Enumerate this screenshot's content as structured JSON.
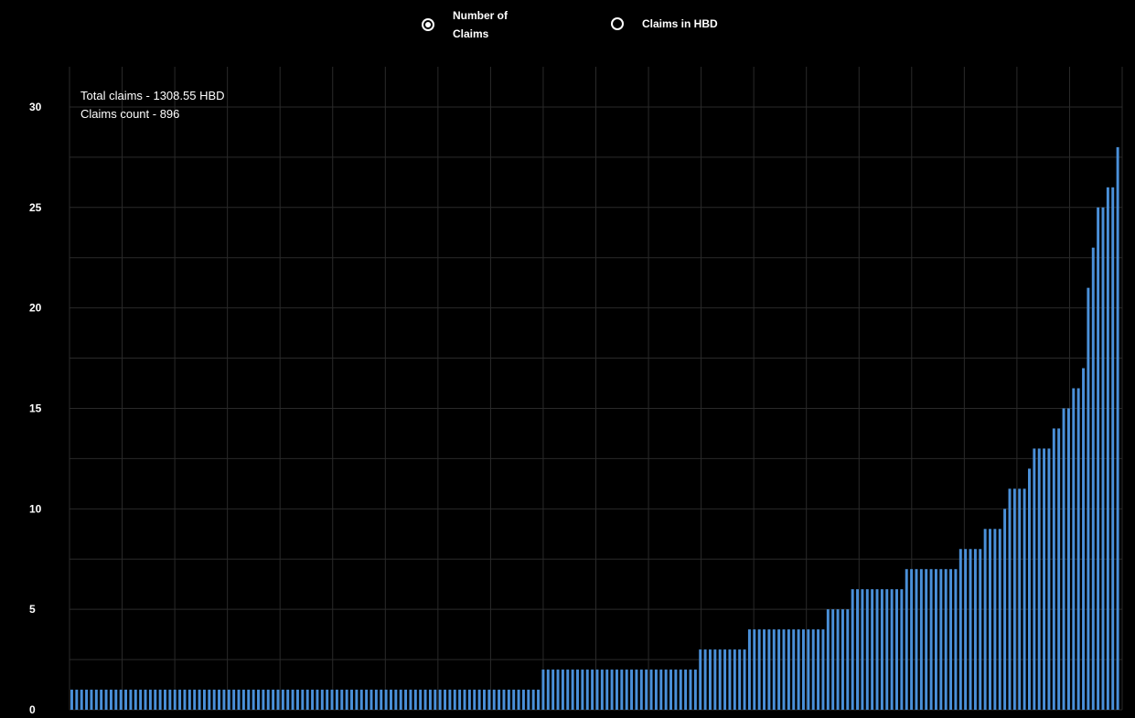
{
  "toggle": {
    "options": [
      {
        "label": "Number of Claims",
        "checked": true
      },
      {
        "label": "Claims in HBD",
        "checked": false
      }
    ]
  },
  "summary": {
    "total_claims": "Total claims - 1308.55 HBD",
    "claims_count": "Claims count - 896"
  },
  "colors": {
    "background": "#000000",
    "bar": "#4a90d9",
    "grid": "#2a2a2a",
    "text": "#ffffff"
  },
  "chart_data": {
    "type": "bar",
    "title": "",
    "xlabel": "",
    "ylabel": "",
    "ylim": [
      0,
      32
    ],
    "yticks": [
      0,
      5,
      10,
      15,
      20,
      25,
      30
    ],
    "grid": true,
    "legend": "none",
    "values": [
      1,
      1,
      1,
      1,
      1,
      1,
      1,
      1,
      1,
      1,
      1,
      1,
      1,
      1,
      1,
      1,
      1,
      1,
      1,
      1,
      1,
      1,
      1,
      1,
      1,
      1,
      1,
      1,
      1,
      1,
      1,
      1,
      1,
      1,
      1,
      1,
      1,
      1,
      1,
      1,
      1,
      1,
      1,
      1,
      1,
      1,
      1,
      1,
      1,
      1,
      1,
      1,
      1,
      1,
      1,
      1,
      1,
      1,
      1,
      1,
      1,
      1,
      1,
      1,
      1,
      1,
      1,
      1,
      1,
      1,
      1,
      1,
      1,
      1,
      1,
      1,
      1,
      1,
      1,
      1,
      1,
      1,
      1,
      1,
      1,
      1,
      1,
      1,
      1,
      1,
      1,
      1,
      1,
      1,
      1,
      1,
      2,
      2,
      2,
      2,
      2,
      2,
      2,
      2,
      2,
      2,
      2,
      2,
      2,
      2,
      2,
      2,
      2,
      2,
      2,
      2,
      2,
      2,
      2,
      2,
      2,
      2,
      2,
      2,
      2,
      2,
      2,
      2,
      3,
      3,
      3,
      3,
      3,
      3,
      3,
      3,
      3,
      3,
      4,
      4,
      4,
      4,
      4,
      4,
      4,
      4,
      4,
      4,
      4,
      4,
      4,
      4,
      4,
      4,
      5,
      5,
      5,
      5,
      5,
      6,
      6,
      6,
      6,
      6,
      6,
      6,
      6,
      6,
      6,
      6,
      7,
      7,
      7,
      7,
      7,
      7,
      7,
      7,
      7,
      7,
      7,
      8,
      8,
      8,
      8,
      8,
      9,
      9,
      9,
      9,
      10,
      11,
      11,
      11,
      11,
      12,
      13,
      13,
      13,
      13,
      14,
      14,
      15,
      15,
      16,
      16,
      17,
      21,
      23,
      25,
      25,
      26,
      26,
      28
    ]
  }
}
